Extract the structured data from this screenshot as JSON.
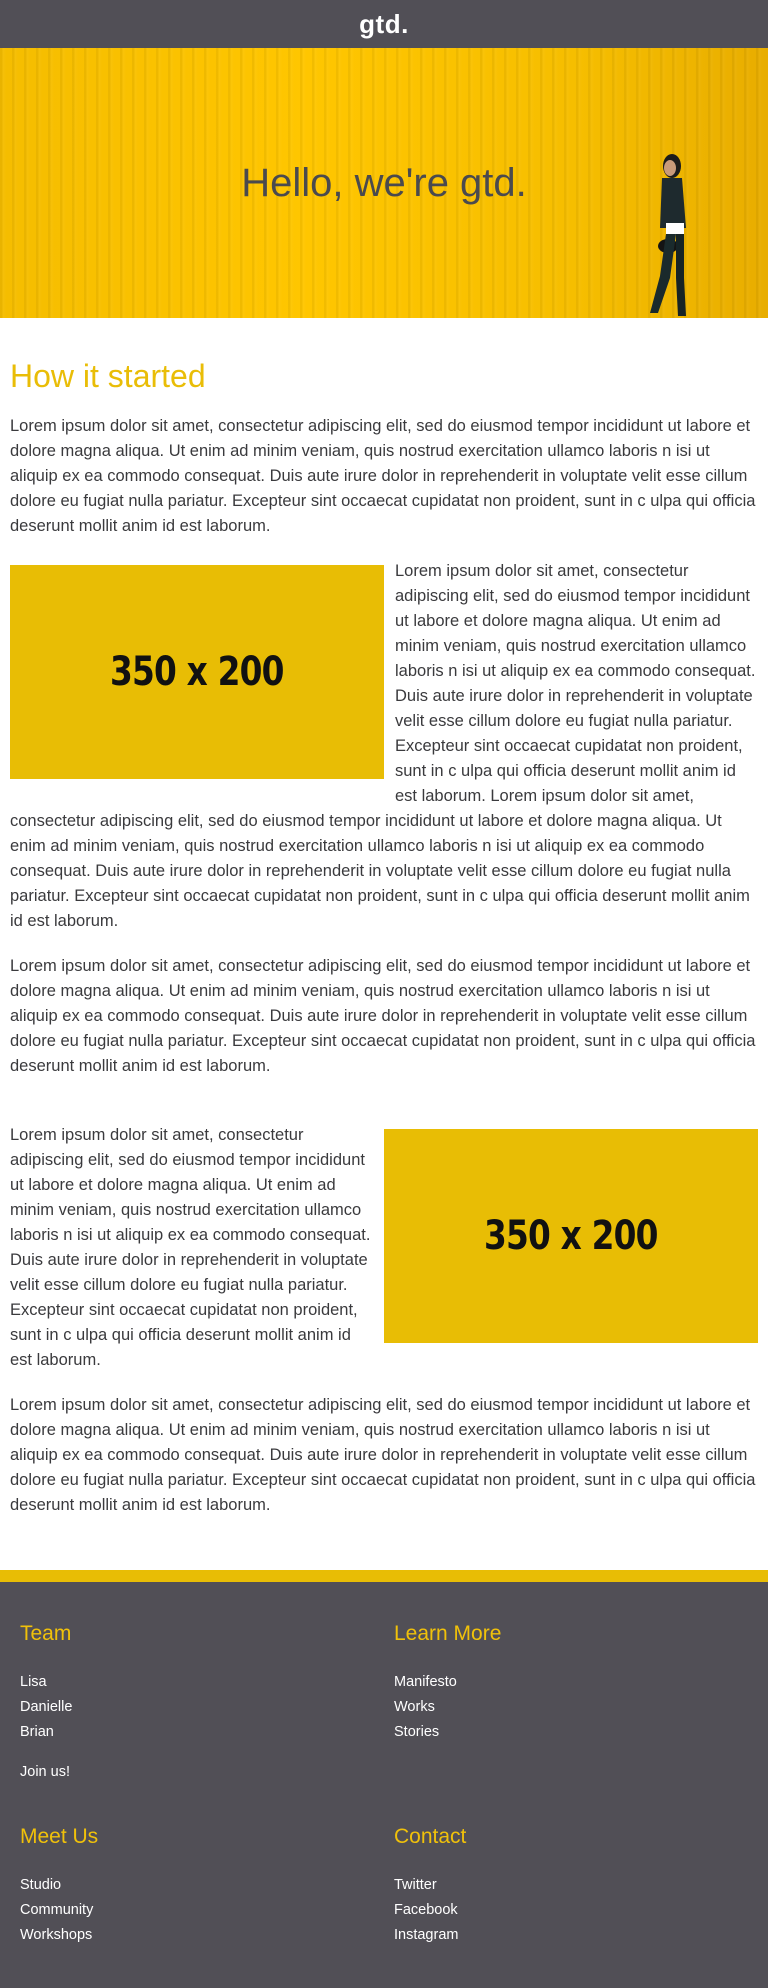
{
  "header": {
    "logo": "gtd."
  },
  "hero": {
    "title": "Hello, we're gtd."
  },
  "main": {
    "heading": "How it started",
    "para1": "Lorem ipsum dolor sit amet, consectetur adipiscing elit, sed do eiusmod tempor incididunt ut labore et dolore magna aliqua. Ut enim ad minim veniam, quis nostrud exercitation ullamco laboris n isi ut aliquip ex ea commodo consequat. Duis aute irure dolor in reprehenderit in voluptate velit esse cillum dolore eu fugiat nulla pariatur. Excepteur sint occaecat cupidatat non proident, sunt in c ulpa qui officia deserunt mollit anim id est laborum.",
    "image1_label": "350 x 200",
    "para2": "Lorem ipsum dolor sit amet, consectetur adipiscing elit, sed do eiusmod tempor incididunt ut labore et dolore magna aliqua. Ut enim ad minim veniam, quis nostrud exercitation ullamco laboris n isi ut aliquip ex ea commodo consequat. Duis aute irure dolor in reprehenderit in voluptate velit esse cillum dolore eu fugiat nulla pariatur. Excepteur sint occaecat cupidatat non proident, sunt in c ulpa qui officia deserunt mollit anim id est laborum. Lorem ipsum dolor sit amet, consectetur adipiscing elit, sed do eiusmod tempor incididunt ut labore et dolore magna aliqua. Ut enim ad minim veniam, quis nostrud exercitation ullamco laboris n isi ut aliquip ex ea commodo consequat. Duis aute irure dolor in reprehenderit in voluptate velit esse cillum dolore eu fugiat nulla pariatur. Excepteur sint occaecat cupidatat non proident, sunt in c ulpa qui officia deserunt mollit anim id est laborum.",
    "para3": "Lorem ipsum dolor sit amet, consectetur adipiscing elit, sed do eiusmod tempor incididunt ut labore et dolore magna aliqua. Ut enim ad minim veniam, quis nostrud exercitation ullamco laboris n isi ut aliquip ex ea commodo consequat. Duis aute irure dolor in reprehenderit in voluptate velit esse cillum dolore eu fugiat nulla pariatur. Excepteur sint occaecat cupidatat non proident, sunt in c ulpa qui officia deserunt mollit anim id est laborum.",
    "image2_label": "350 x 200",
    "para4": "Lorem ipsum dolor sit amet, consectetur adipiscing elit, sed do eiusmod tempor incididunt ut labore et dolore magna aliqua. Ut enim ad minim veniam, quis nostrud exercitation ullamco laboris n isi ut aliquip ex ea commodo consequat. Duis aute irure dolor in reprehenderit in voluptate velit esse cillum dolore eu fugiat nulla pariatur. Excepteur sint occaecat cupidatat non proident, sunt in c ulpa qui officia deserunt mollit anim id est laborum.",
    "para5": "Lorem ipsum dolor sit amet, consectetur adipiscing elit, sed do eiusmod tempor incididunt ut labore et dolore magna aliqua. Ut enim ad minim veniam, quis nostrud exercitation ullamco laboris n isi ut aliquip ex ea commodo consequat. Duis aute irure dolor in reprehenderit in voluptate velit esse cillum dolore eu fugiat nulla pariatur. Excepteur sint occaecat cupidatat non proident, sunt in c ulpa qui officia deserunt mollit anim id est laborum."
  },
  "footer": {
    "team": {
      "title": "Team",
      "links": [
        "Lisa",
        "Danielle",
        "Brian"
      ],
      "join": "Join us!"
    },
    "learn_more": {
      "title": "Learn More",
      "links": [
        "Manifesto",
        "Works",
        "Stories"
      ]
    },
    "meet_us": {
      "title": "Meet Us",
      "links": [
        "Studio",
        "Community",
        "Workshops"
      ]
    },
    "contact": {
      "title": "Contact",
      "links": [
        "Twitter",
        "Facebook",
        "Instagram"
      ]
    }
  },
  "colors": {
    "accent": "#e8bd05",
    "dark": "#514f56",
    "text": "#3a3a3d"
  }
}
